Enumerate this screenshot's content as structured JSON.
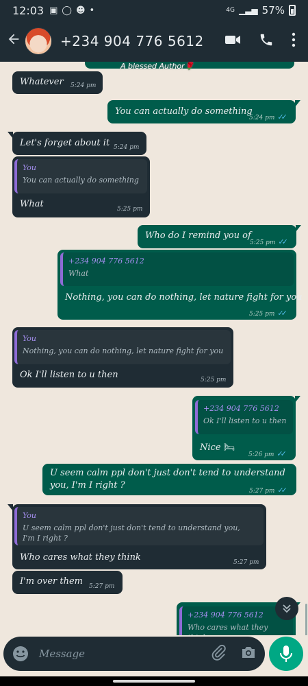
{
  "status_bar": {
    "time": "12:03",
    "network": "4G",
    "battery": "57%"
  },
  "header": {
    "contact_name": "+234 904 776 5612"
  },
  "banner": {
    "caption": "A blessed Author🌹"
  },
  "messages": [
    {
      "dir": "in",
      "text": "Whatever",
      "time": "5:24 pm"
    },
    {
      "dir": "out",
      "text": "You can actually do something",
      "time": "5:24 pm"
    },
    {
      "dir": "in",
      "text": "Let's forget about it",
      "time": "5:24 pm"
    },
    {
      "dir": "in",
      "quote_author": "You",
      "quote_text": "You can actually do something",
      "text": "What",
      "time": "5:25 pm"
    },
    {
      "dir": "out",
      "text": "Who do I remind you of",
      "time": "5:25 pm"
    },
    {
      "dir": "out",
      "quote_author": "+234 904 776 5612",
      "quote_text": "What",
      "text": "Nothing, you can do nothing, let nature fight for you",
      "time": "5:25 pm"
    },
    {
      "dir": "in",
      "quote_author": "You",
      "quote_text": "Nothing, you can do nothing, let nature fight for you",
      "text": "Ok I'll listen to u then",
      "time": "5:25 pm"
    },
    {
      "dir": "out",
      "quote_author": "+234 904 776 5612",
      "quote_text": "Ok I'll listen to u then",
      "text": "Nice",
      "emoji": "🛏",
      "time": "5:26 pm"
    },
    {
      "dir": "out",
      "text": "U seem calm ppl don't just don't tend to understand",
      "text2": "you, I'm I right ?",
      "time": "5:27 pm"
    },
    {
      "dir": "in",
      "quote_author": "You",
      "quote_text": "U seem calm ppl don't just don't tend to understand you,",
      "quote_text2": "I'm I right ?",
      "text": "Who cares what they think",
      "time": "5:27 pm"
    },
    {
      "dir": "in",
      "text": "I'm over them",
      "time": "5:27 pm"
    },
    {
      "dir": "out",
      "quote_author": "+234 904 776 5612",
      "quote_text": "Who cares what they think"
    }
  ],
  "composer": {
    "placeholder": "Message"
  },
  "colors": {
    "incoming": "#1f2c34",
    "outgoing": "#005c4b",
    "accent": "#00a884",
    "read_ticks": "#53bdeb"
  },
  "icons": [
    "back-arrow-icon",
    "video-call-icon",
    "phone-icon",
    "more-options-icon",
    "emoji-icon",
    "attach-icon",
    "camera-icon",
    "mic-icon",
    "scroll-down-icon"
  ]
}
